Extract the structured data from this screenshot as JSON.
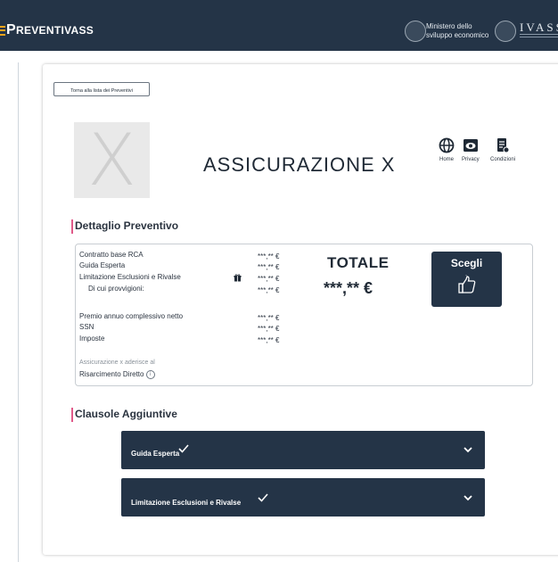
{
  "header": {
    "logo_prefix": "P",
    "logo_rest": "REVENTIVASS",
    "ministry_line1": "Ministero dello",
    "ministry_line2": "sviluppo economico",
    "ivass": "IVASS"
  },
  "back_button": "Torna alla lista dei Preventivi",
  "company": {
    "placeholder_letter": "X",
    "name": "ASSICURAZIONE X"
  },
  "nav": [
    {
      "label": "Home",
      "icon": "globe-icon"
    },
    {
      "label": "Privacy",
      "icon": "eye-icon"
    },
    {
      "label": "Condizioni",
      "icon": "document-icon"
    }
  ],
  "detail": {
    "title": "Dettaglio Preventivo",
    "rows": [
      {
        "label": "Contratto base RCA",
        "value": "***,** €"
      },
      {
        "label": "Guida Esperta",
        "value": "***,** €"
      },
      {
        "label": "Limitazione Esclusioni e Rivalse",
        "value": "***,** €"
      },
      {
        "label": "Di cui provvigioni:",
        "value": "***,** €"
      },
      {
        "label": "Premio annuo complessivo netto",
        "value": "***,** €"
      },
      {
        "label": "SSN",
        "value": "***,** €"
      },
      {
        "label": "Imposte",
        "value": "***,** €"
      }
    ],
    "note_line1": "Assicurazione x aderisce al",
    "note_line2": "Risarcimento Diretto",
    "totale_label": "TOTALE",
    "totale_value": "***,** €",
    "choose_label": "Scegli"
  },
  "clauses": {
    "title": "Clausole Aggiuntive",
    "items": [
      {
        "label": "Guida Esperta"
      },
      {
        "label": "Limitazione Esclusioni e Rivalse"
      }
    ]
  },
  "colors": {
    "navy": "#243447",
    "accent_pink": "#e05a8a",
    "logo_orange": "#f2a31b"
  }
}
